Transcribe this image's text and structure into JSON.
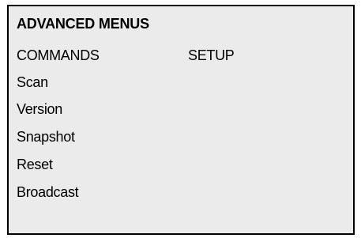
{
  "panel": {
    "title": "ADVANCED MENUS",
    "columns": {
      "commands": "COMMANDS",
      "setup": "SETUP"
    },
    "items": [
      {
        "label": "Scan"
      },
      {
        "label": "Version"
      },
      {
        "label": "Snapshot"
      },
      {
        "label": "Reset"
      },
      {
        "label": "Broadcast"
      }
    ]
  },
  "colors": {
    "background": "#ebebeb",
    "border": "#000000",
    "text": "#000000"
  }
}
